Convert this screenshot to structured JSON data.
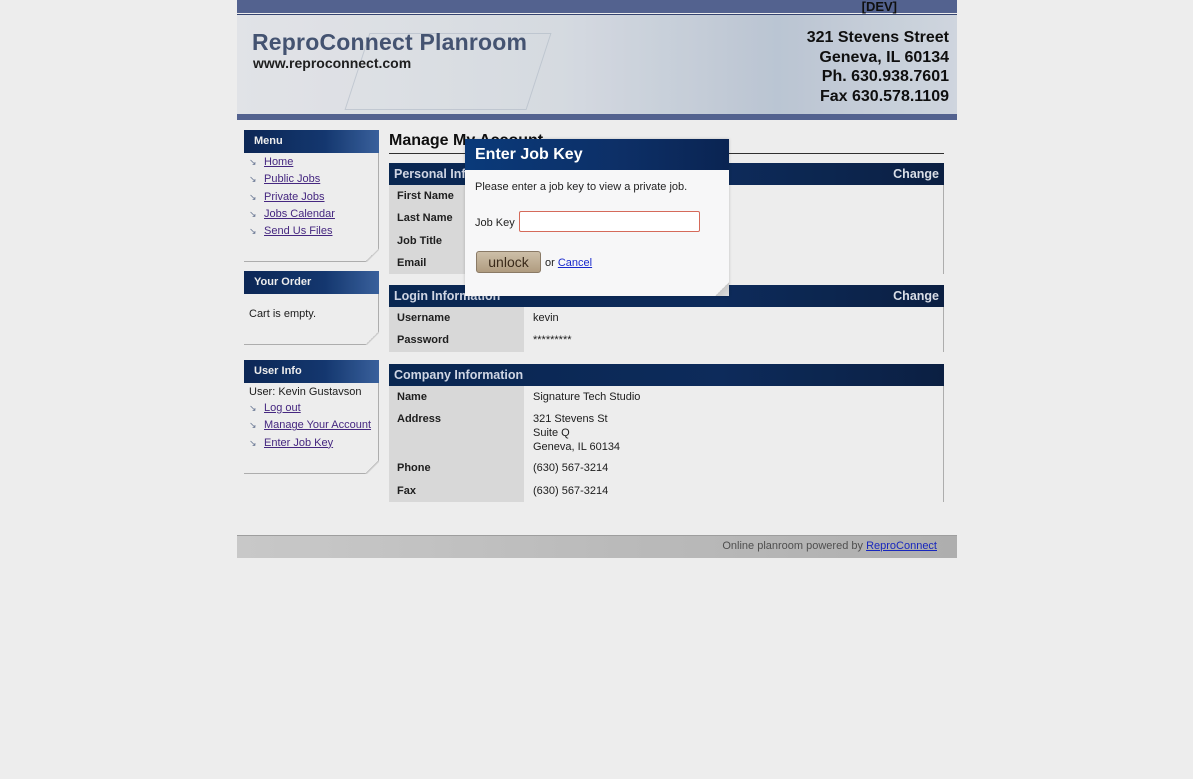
{
  "env_tag": "[DEV]",
  "header": {
    "title": "ReproConnect Planroom",
    "url": "www.reproconnect.com",
    "address": [
      "321 Stevens Street",
      "Geneva, IL 60134",
      "Ph. 630.938.7601",
      "Fax 630.578.1109"
    ]
  },
  "sidebar": {
    "menu": {
      "title": "Menu",
      "items": [
        {
          "label": "Home"
        },
        {
          "label": "Public Jobs"
        },
        {
          "label": "Private Jobs"
        },
        {
          "label": "Jobs Calendar"
        },
        {
          "label": "Send Us Files"
        }
      ]
    },
    "order": {
      "title": "Your Order",
      "cart_text": "Cart is empty."
    },
    "user_info": {
      "title": "User Info",
      "user_line": "User: Kevin Gustavson",
      "items": [
        {
          "label": "Log out"
        },
        {
          "label": "Manage Your Account"
        },
        {
          "label": "Enter Job Key"
        }
      ]
    }
  },
  "main": {
    "page_title": "Manage My Account",
    "personal": {
      "title": "Personal Information",
      "change_label": "Change",
      "rows": [
        {
          "label": "First Name",
          "value": ""
        },
        {
          "label": "Last Name",
          "value": ""
        },
        {
          "label": "Job Title",
          "value": ""
        },
        {
          "label": "Email",
          "value": ""
        }
      ]
    },
    "login": {
      "title": "Login Information",
      "change_label": "Change",
      "rows": [
        {
          "label": "Username",
          "value": "kevin"
        },
        {
          "label": "Password",
          "value": "*********"
        }
      ]
    },
    "company": {
      "title": "Company Information",
      "rows": [
        {
          "label": "Name",
          "value": "Signature Tech Studio"
        },
        {
          "label": "Address",
          "lines": [
            "321 Stevens St",
            "Suite Q",
            "Geneva, IL 60134"
          ]
        },
        {
          "label": "Phone",
          "value": "(630) 567-3214"
        },
        {
          "label": "Fax",
          "value": "(630) 567-3214"
        }
      ]
    }
  },
  "footer": {
    "text": "Online planroom powered by",
    "link": "ReproConnect"
  },
  "dialog": {
    "title": "Enter Job Key",
    "instruction": "Please enter a job key to view a private job.",
    "field_label": "Job Key",
    "field_value": "",
    "unlock_label": "unlock",
    "or_text": "or",
    "cancel_label": "Cancel"
  }
}
